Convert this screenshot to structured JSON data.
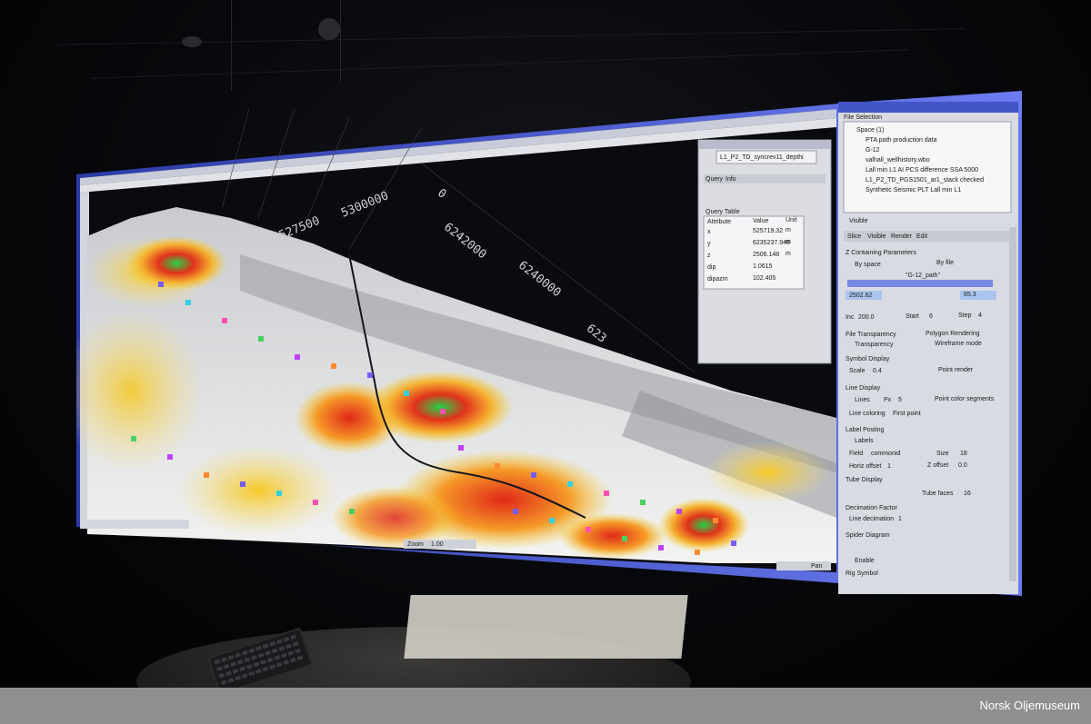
{
  "screen": {
    "main_window_title": "",
    "axis_labels": [
      "6242000",
      "6240000",
      "5300000",
      "527500",
      "623",
      "0"
    ],
    "query_table": {
      "title": "L1_P2_TD_syncrev11_depthi",
      "tabs": [
        "Query",
        "Info"
      ],
      "header": "Query Table",
      "columns": [
        "Attribute",
        "Value",
        "Unit"
      ],
      "rows": [
        [
          "x",
          "525719.32",
          "m"
        ],
        [
          "y",
          "6235237.946",
          "m"
        ],
        [
          "z",
          "2506.148",
          "m"
        ],
        [
          "dip",
          "1.0615",
          ""
        ],
        [
          "dipazm",
          "102.405",
          ""
        ]
      ]
    },
    "right_panel": {
      "file_selection_label": "File Selection",
      "tree_items": [
        "Space (1)",
        "PTA path production data",
        "G-12",
        "valhall_wellhistory.wbo",
        "Lall min L1 AI PCS difference SSA 5000",
        "L1_P2_TD_PGS1501_ar1_stack checked",
        "Synthetic Seismic PLT Lall min L1"
      ],
      "visible_label": "Visible",
      "tabs": [
        "Slice",
        "Visible",
        "Render",
        "Edit"
      ],
      "z_params_label": "Z Containing Parameters",
      "by_space": "By space",
      "by_file": "By file",
      "file_name": "\"G-12_path\"",
      "z_value_left": "2502.62",
      "z_value_right": "65.3",
      "inc_label": "Inc",
      "inc_value": "200.0",
      "start_label": "Start",
      "start_value": "6",
      "step_label": "Step",
      "step_value": "4",
      "file_transparency": "File Transparency",
      "transparency": "Transparency",
      "polygon_rendering": "Polygon Rendering",
      "wireframe_mode": "Wireframe mode",
      "symbol_display": "Symbol Display",
      "scale_label": "Scale",
      "scale_value": "0.4",
      "point_render": "Point render",
      "line_display": "Line Display",
      "lines": "Lines",
      "px_label": "Px",
      "px_value": "5",
      "point_color_segments": "Point color segments",
      "line_coloring": "Line coloring",
      "line_coloring_value": "First point",
      "label_posting": "Label Posting",
      "labels": "Labels",
      "field_label": "Field",
      "field_value": "commonid",
      "size_label": "Size",
      "size_value": "18",
      "horiz_offset": "Horiz offset",
      "horiz_value": "1",
      "z_offset": "Z offset",
      "z_offset_value": "0.0",
      "tube_display": "Tube Display",
      "tube_faces": "Tube faces",
      "tube_faces_value": "16",
      "decimation_factor": "Decimation Factor",
      "line_decimation": "Line decimation",
      "line_decimation_value": "1",
      "spider_diagram": "Spider Diagram",
      "enable": "Enable",
      "rig_symbol": "Rig Symbol"
    },
    "bottom_bar": {
      "zoom_label": "Zoom",
      "zoom_value": "1.00",
      "pan_label": "Pan"
    }
  },
  "caption": {
    "credit": "Norsk Oljemuseum"
  },
  "colors": {
    "screen_frame": "#5a6ad8",
    "panel_bg": "#d9dbe3",
    "seismic_hot": "#e02818",
    "seismic_warm": "#f5d230",
    "seismic_cool": "#2fd36a"
  }
}
